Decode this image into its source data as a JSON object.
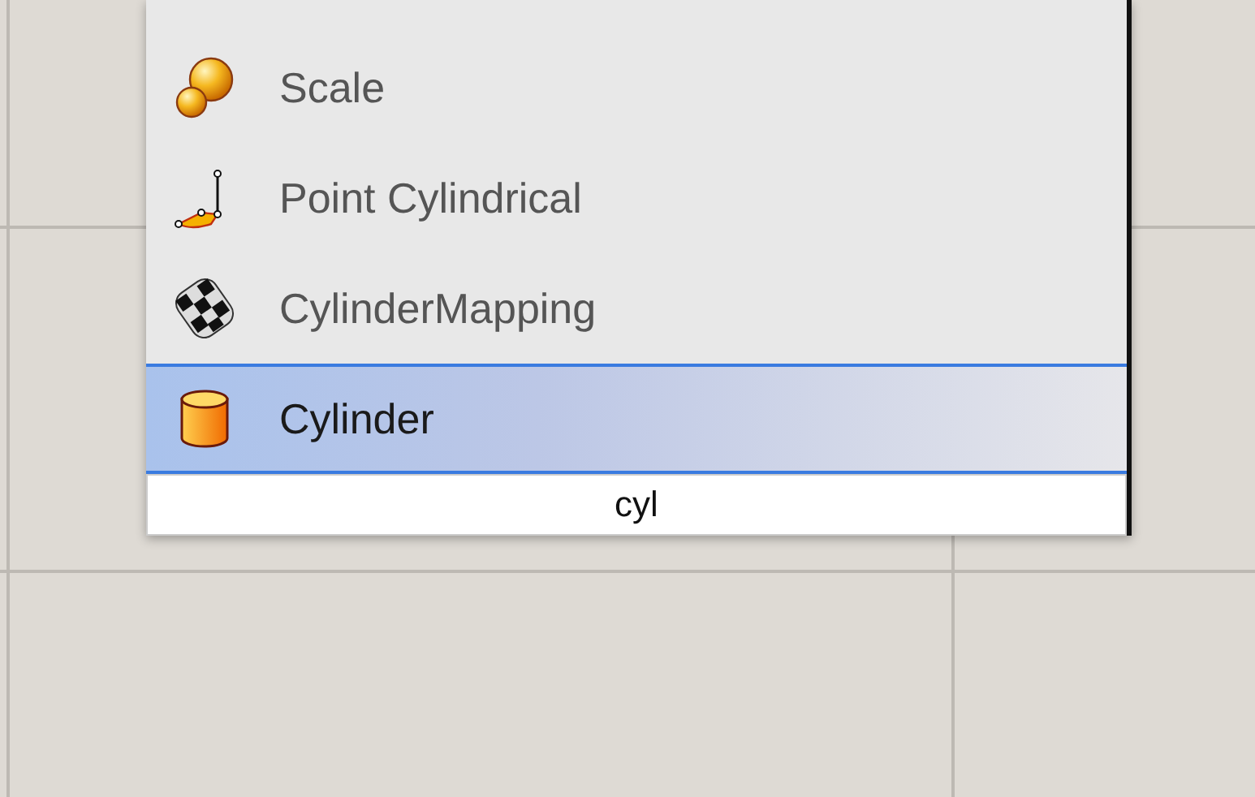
{
  "items": [
    {
      "label": "Scale",
      "kind": "spheres",
      "selected": false
    },
    {
      "label": "Point Cylindrical",
      "kind": "point",
      "selected": false
    },
    {
      "label": "CylinderMapping",
      "kind": "checker",
      "selected": false
    },
    {
      "label": "Cylinder",
      "kind": "cylinder",
      "selected": true
    }
  ],
  "search": {
    "value": "cyl"
  }
}
